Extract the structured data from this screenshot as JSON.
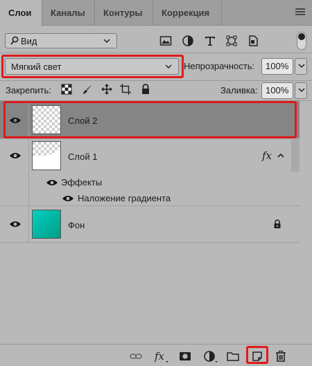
{
  "tabs": [
    {
      "label": "Слои",
      "active": true
    },
    {
      "label": "Каналы",
      "active": false
    },
    {
      "label": "Контуры",
      "active": false
    },
    {
      "label": "Коррекция",
      "active": false
    }
  ],
  "filter": {
    "label": "Вид"
  },
  "blend": {
    "mode": "Мягкий свет"
  },
  "opacity": {
    "label": "Непрозрачность:",
    "value": "100%"
  },
  "lock": {
    "label": "Закрепить:"
  },
  "fill": {
    "label": "Заливка:",
    "value": "100%"
  },
  "layers": [
    {
      "name": "Слой 2",
      "selected": true,
      "visible": true
    },
    {
      "name": "Слой 1",
      "selected": false,
      "visible": true,
      "fx": "fx",
      "effects_label": "Эффекты",
      "effects": [
        {
          "name": "Наложение градиента"
        }
      ]
    },
    {
      "name": "Фон",
      "selected": false,
      "visible": true,
      "locked": true
    }
  ],
  "colors": {
    "highlight": "#e0191b",
    "selected_row": "#858585",
    "background_thumb": "#16b9a4"
  }
}
